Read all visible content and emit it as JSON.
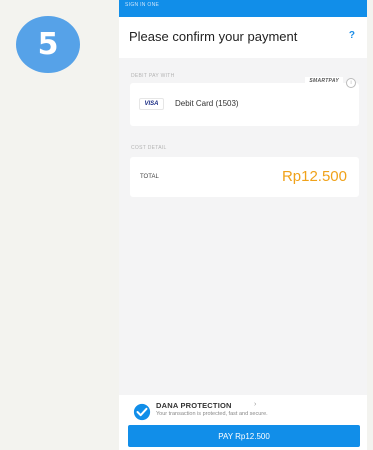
{
  "step_number": "5",
  "status_bar": {
    "text": "SIGN IN ONE"
  },
  "header": {
    "title": "Please confirm your payment",
    "help_icon": "?"
  },
  "payment": {
    "section_label": "DEBIT PAY WITH",
    "badge": "SMARTPAY",
    "card_brand": "VISA",
    "method_label": "Debit Card (1503)"
  },
  "cost": {
    "section_label": "COST DETAIL",
    "total_label": "TOTAL",
    "total_amount": "Rp12.500"
  },
  "protection": {
    "title": "DANA PROTECTION",
    "description": "Your transaction is protected, fast and secure."
  },
  "pay_button": {
    "label": "PAY Rp12.500"
  },
  "colors": {
    "brand_blue": "#118ee9",
    "amount_orange": "#f0a21a",
    "step_badge": "#56a2e8"
  }
}
